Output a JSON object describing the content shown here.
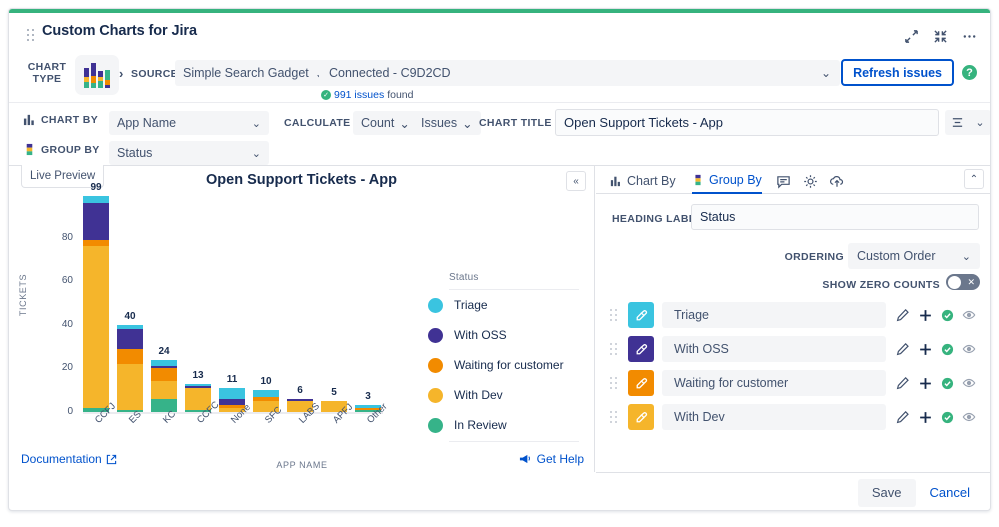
{
  "window": {
    "title": "Custom Charts for Jira",
    "controls": [
      {
        "name": "collapse-expand-icon",
        "glyph": "⤡"
      },
      {
        "name": "minimize-icon",
        "glyph": "⤢"
      },
      {
        "name": "more-options-icon",
        "glyph": "···"
      }
    ]
  },
  "config": {
    "chart_type_label": "CHART TYPE",
    "source_label": "SOURCE",
    "source_value": "Simple Search Gadget",
    "connection_value": "Connected - C9D2CD",
    "issues_count": "991 issues",
    "issues_found_suffix": "found",
    "refresh_label": "Refresh issues",
    "chart_by_label": "CHART BY",
    "chart_by_value": "App Name",
    "group_by_label": "GROUP BY",
    "group_by_value": "Status",
    "calculate_label": "CALCULATE",
    "calculate_value": "Count",
    "calculate_unit": "Issues",
    "chart_title_label": "CHART TITLE",
    "chart_title_value": "Open Support Tickets - App"
  },
  "preview": {
    "tab_label": "Live Preview",
    "title": "Open Support Tickets - App",
    "documentation_label": "Documentation",
    "get_help_label": "Get Help"
  },
  "settings": {
    "tabs": [
      {
        "label": "Chart By",
        "active": false,
        "name": "tab-chart-by"
      },
      {
        "label": "Group By",
        "active": true,
        "name": "tab-group-by"
      }
    ],
    "icon_tabs": [
      "comment-icon",
      "gear-icon",
      "cloud-upload-icon"
    ],
    "heading_label": "HEADING LABEL",
    "heading_value": "Status",
    "ordering_label": "ORDERING",
    "ordering_value": "Custom Order",
    "show_zero_counts_label": "SHOW ZERO COUNTS",
    "show_zero_counts_on": false,
    "rows": [
      {
        "label": "Triage",
        "color": "#3ac4e0",
        "visible": true
      },
      {
        "label": "With OSS",
        "color": "#403294",
        "visible": true
      },
      {
        "label": "Waiting for customer",
        "color": "#f28b00",
        "visible": true
      },
      {
        "label": "With Dev",
        "color": "#f5b52b",
        "visible": true
      },
      {
        "label": "In Review",
        "color": "#36b389",
        "visible": true
      },
      {
        "label": "",
        "color": "#bf2600",
        "visible": true
      }
    ],
    "save_label": "Save",
    "cancel_label": "Cancel"
  },
  "chart_data": {
    "type": "bar",
    "subtype": "stacked-column",
    "title": "Open Support Tickets - App",
    "xlabel": "APP NAME",
    "ylabel": "TICKETS",
    "ylim": [
      0,
      100
    ],
    "yticks": [
      0,
      20,
      40,
      60,
      80
    ],
    "grid": false,
    "legend_title": "Status",
    "legend_position": "right",
    "categories": [
      "CCFJ",
      "ES",
      "KC",
      "CCFC",
      "None",
      "SFC",
      "LABS",
      "APFJ",
      "Other"
    ],
    "totals": [
      99,
      40,
      24,
      13,
      11,
      10,
      6,
      5,
      3
    ],
    "series": [
      {
        "name": "Triage",
        "color": "#3ac4e0",
        "values": [
          3,
          2,
          3,
          1,
          5,
          3,
          0,
          0,
          1
        ]
      },
      {
        "name": "With OSS",
        "color": "#403294",
        "values": [
          17,
          9,
          1,
          1,
          3,
          0,
          1,
          0,
          0
        ]
      },
      {
        "name": "Waiting for customer",
        "color": "#f28b00",
        "values": [
          3,
          7,
          6,
          0,
          1,
          2,
          0,
          0,
          1
        ]
      },
      {
        "name": "With Dev",
        "color": "#f5b52b",
        "values": [
          74,
          21,
          8,
          10,
          2,
          5,
          5,
          5,
          0
        ]
      },
      {
        "name": "In Review",
        "color": "#36b389",
        "values": [
          2,
          1,
          6,
          1,
          0,
          0,
          0,
          0,
          1
        ]
      }
    ]
  }
}
